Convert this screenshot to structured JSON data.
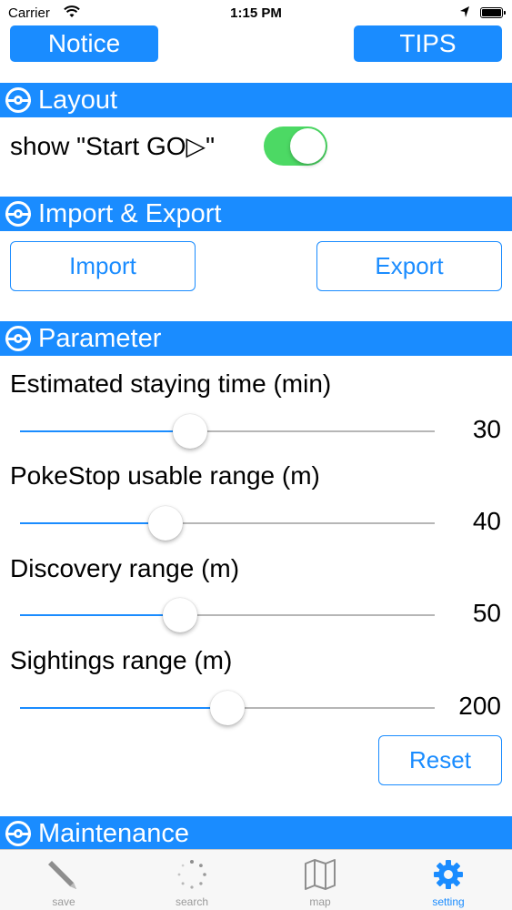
{
  "status_bar": {
    "carrier": "Carrier",
    "time": "1:15 PM"
  },
  "top_buttons": {
    "notice": "Notice",
    "tips": "TIPS"
  },
  "sections": {
    "layout": "Layout",
    "import_export": "Import & Export",
    "parameter": "Parameter",
    "maintenance": "Maintenance"
  },
  "layout": {
    "show_start_label": "show \"Start GO▷\"",
    "show_start_enabled": true
  },
  "import_export": {
    "import_label": "Import",
    "export_label": "Export"
  },
  "parameters": [
    {
      "label": "Estimated staying time (min)",
      "value": "30",
      "fraction": 0.41
    },
    {
      "label": "PokeStop usable range (m)",
      "value": "40",
      "fraction": 0.35
    },
    {
      "label": "Discovery range (m)",
      "value": "50",
      "fraction": 0.385
    },
    {
      "label": "Sightings range (m)",
      "value": "200",
      "fraction": 0.5
    }
  ],
  "reset_label": "Reset",
  "tab_bar": {
    "tabs": [
      {
        "label": "save",
        "icon": "pencil-icon",
        "active": false
      },
      {
        "label": "search",
        "icon": "spinner-icon",
        "active": false
      },
      {
        "label": "map",
        "icon": "map-icon",
        "active": false
      },
      {
        "label": "setting",
        "icon": "gear-icon",
        "active": true
      }
    ]
  },
  "colors": {
    "accent": "#1a8cff",
    "toggle_on": "#4cd964",
    "inactive_tab": "#9a9a9a"
  }
}
